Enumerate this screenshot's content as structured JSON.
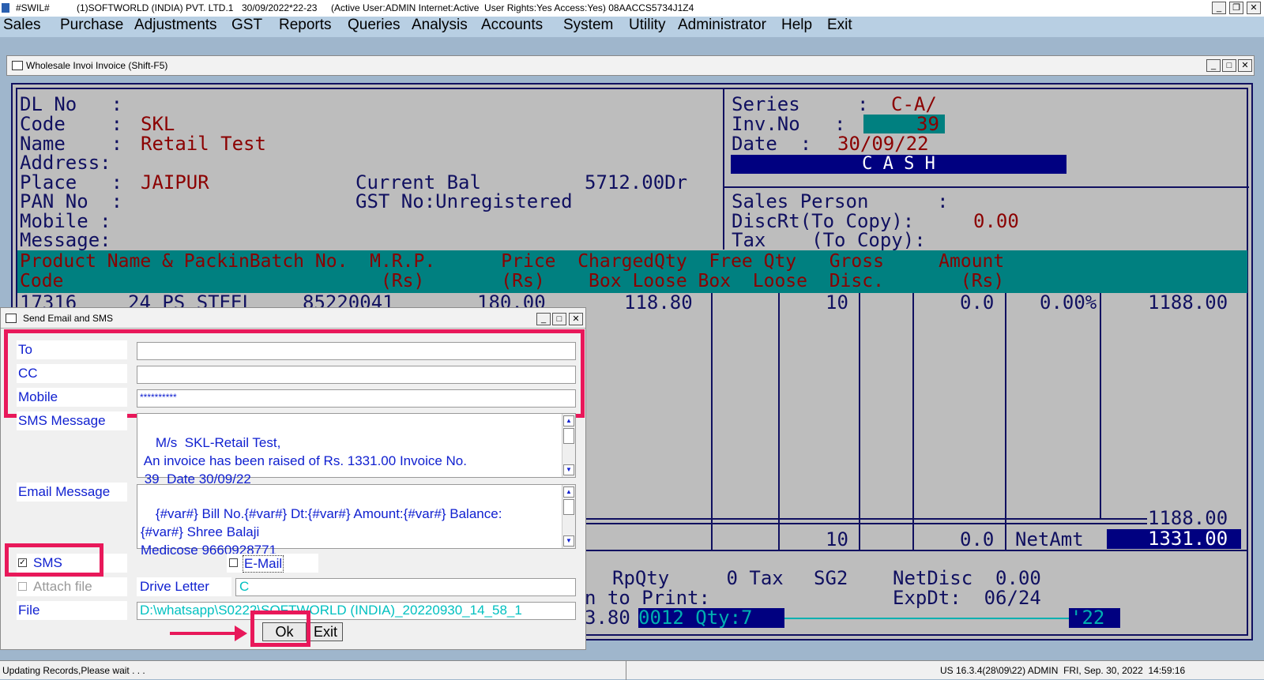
{
  "titlebar": {
    "app": "#SWIL#",
    "company": "(1)SOFTWORLD (INDIA) PVT. LTD.1",
    "fy": "30/09/2022*22-23",
    "status": "(Active User:ADMIN Internet:Active  User Rights:Yes Access:Yes) 08AACCS5734J1Z4"
  },
  "menu": [
    "Sales",
    "Purchase",
    "Adjustments",
    "GST",
    "Reports",
    "Queries",
    "Analysis",
    "Accounts",
    "System",
    "Utility",
    "Administrator",
    "Help",
    "Exit"
  ],
  "invoice_window": {
    "title": "Wholesale Invoi Invoice (Shift-F5)"
  },
  "invoice": {
    "labels": {
      "dl": "DL No   :",
      "code": "Code    :",
      "name": "Name    :",
      "address": "Address:",
      "place": "Place   :",
      "pan": "PAN No  :",
      "mobile": "Mobile :",
      "message": "Message:"
    },
    "code": "SKL",
    "name": "Retail Test",
    "place": "JAIPUR",
    "curbal_label": "Current Bal",
    "curbal_value": "5712.00Dr",
    "gst": "GST No:Unregistered",
    "series_label": "Series     :",
    "series": "C-A/",
    "invno_label": "Inv.No   :",
    "invno": "39",
    "date_label": "Date  :",
    "date": "30/09/22",
    "cash": "C A S H",
    "salesperson": "Sales Person      :",
    "discrt_label": "DiscRt(To Copy):",
    "discrt": "0.00",
    "tax_label": "Tax    (To Copy):",
    "grid_headers": {
      "r1": "Product Name & PackinBatch No.  M.R.P.      Price  ChargedQty  Free Qty   Gross     Amount",
      "r2": "Code                             (Rs)       (Rs)    Box Loose Box  Loose  Disc.       (Rs)"
    },
    "row": {
      "code": "17316",
      "name": "24 PS STEEL",
      "batch": "85220041",
      "mrp": "180.00",
      "price": "118.80",
      "loose": "10",
      "freeloose": "0.0",
      "disc": "0.00%",
      "amount": "1188.00"
    },
    "total_amount": "1188.00",
    "tot_qty": "10",
    "tot_free": "0.0",
    "netamt_label": "NetAmt",
    "netamt": "1331.00",
    "rpqty": "RpQty     0 Tax",
    "sg2": "SG2",
    "netdisc": "NetDisc  0.00",
    "toprint": "n to Print:",
    "expdt": "ExpDt:  06/24",
    "bottom_a": "3.80",
    "bottom_b": "0012 Qty:7",
    "bottom_c": "'22"
  },
  "dialog": {
    "title": "Send Email and SMS",
    "to_label": "To",
    "cc_label": "CC",
    "mobile_label": "Mobile",
    "mobile_value": "**********",
    "sms_label": "SMS Message",
    "sms_text": "M/s  SKL-Retail Test,\n An invoice has been raised of Rs. 1331.00 Invoice No.\n 39  Date 30/09/22",
    "email_label": "Email Message",
    "email_text": "{#var#} Bill No.{#var#} Dt:{#var#} Amount:{#var#} Balance:\n{#var#} Shree Balaji\nMedicose 9660928771",
    "sms_check": "SMS",
    "email_check": "E-Mail",
    "attach": "Attach file",
    "drive_label": "Drive Letter",
    "drive_value": "C",
    "file_label": "File",
    "file_value": "D:\\whatsapp\\S0222\\SOFTWORLD (INDIA)_20220930_14_58_1",
    "ok": "Ok",
    "exit": "Exit"
  },
  "statusbar": {
    "left": "Updating Records,Please wait . . .",
    "right": "US 16.3.4(28\\09\\22) ADMIN  FRI, Sep. 30, 2022  14:59:16"
  },
  "colors": {
    "accent_teal": "#008080",
    "highlight": "#e8185a",
    "navy": "#000080"
  }
}
